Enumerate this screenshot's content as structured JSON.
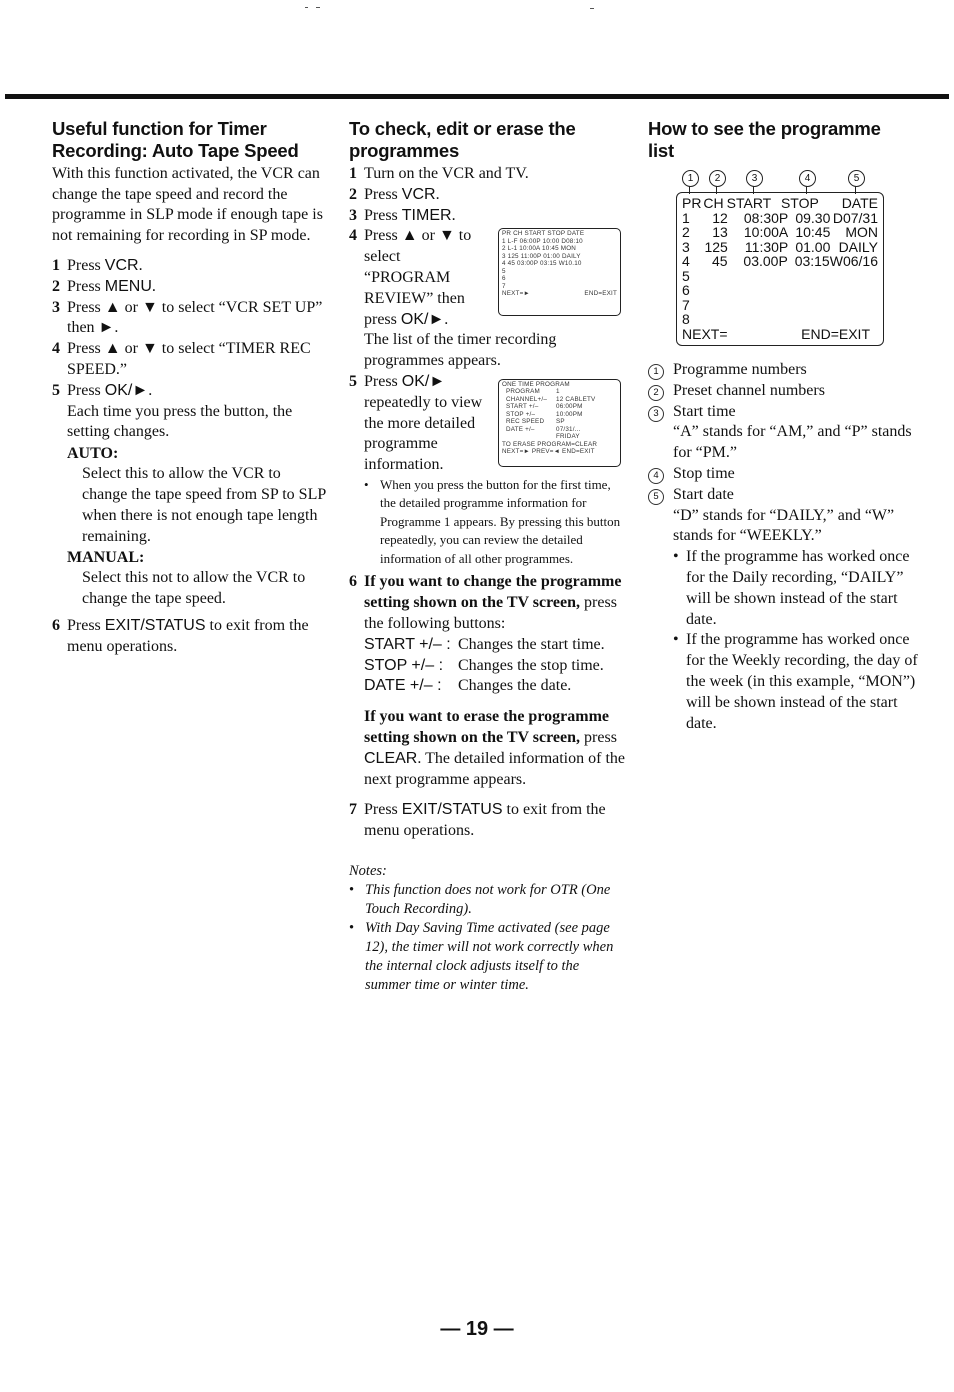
{
  "page_number": "19",
  "column1": {
    "title": "Useful function for Timer Recording: Auto Tape Speed",
    "intro": "With this function activated, the VCR can change the tape speed and record the programme in SLP mode if enough tape is not remaining for recording in SP mode.",
    "steps": [
      {
        "num": "1",
        "pre": "Press ",
        "key": "VCR",
        "post": "."
      },
      {
        "num": "2",
        "pre": "Press ",
        "key": "MENU",
        "post": "."
      },
      {
        "num": "3",
        "pre": "Press ▲ or ▼ to select “VCR SET UP” then ►.",
        "key": "",
        "post": ""
      },
      {
        "num": "4",
        "pre": "Press ▲ or ▼ to select “TIMER REC SPEED.”",
        "key": "",
        "post": ""
      },
      {
        "num": "5",
        "pre": "Press ",
        "key": "OK/►",
        "post": "."
      },
      {
        "num": "6",
        "pre": "Press ",
        "key": "EXIT/STATUS",
        "post": " to exit from the menu operations."
      }
    ],
    "step5_detail": "Each time you press the button, the setting changes.",
    "options": [
      {
        "label": "AUTO:",
        "text": "Select this to allow the VCR to change the tape speed from SP to SLP when there is not enough tape length remaining."
      },
      {
        "label": "MANUAL:",
        "text": "Select this not to allow the VCR to change the tape speed."
      }
    ]
  },
  "column2": {
    "title": "To check, edit or erase the programmes",
    "steps": [
      {
        "num": "1",
        "pre": "Turn on the VCR and TV.",
        "key": "",
        "post": ""
      },
      {
        "num": "2",
        "pre": "Press ",
        "key": "VCR",
        "post": "."
      },
      {
        "num": "3",
        "pre": "Press ",
        "key": "TIMER",
        "post": "."
      },
      {
        "num": "4",
        "pre": "Press ▲ or ▼ to select “PROGRAM REVIEW” then press ",
        "key": "OK/►",
        "post": "."
      },
      {
        "num": "5",
        "pre": "Press ",
        "key": "OK/►",
        "post": " repeatedly to view the more detailed programme information."
      },
      {
        "num": "7",
        "pre": "Press ",
        "key": "EXIT/STATUS",
        "post": " to exit from the menu operations."
      }
    ],
    "step4_lines": [
      "Press ▲ or ▼ to",
      "select",
      "“PROGRAM",
      "REVIEW” then",
      "press"
    ],
    "step4_result": "The list of the timer recording programmes appears.",
    "step5_lines": [
      "repeatedly to view",
      "the more detailed",
      "programme",
      "information."
    ],
    "step5_bullet": "When you press the button for the first time, the detailed programme information for Programme 1 appears. By pressing this button repeatedly, you can review the detailed information of all other programmes.",
    "step6": {
      "num": "6",
      "bold": "If you want to change the programme setting shown on the TV screen,",
      "rest": " press the following buttons:",
      "buttons": [
        {
          "key": "START +/– :",
          "desc": "Changes the start time."
        },
        {
          "key": "STOP +/– :",
          "desc": "Changes the stop time."
        },
        {
          "key": "DATE +/– :",
          "desc": "Changes the date."
        }
      ]
    },
    "erase": {
      "bold": "If you want to erase the programme setting shown on the TV screen,",
      "pre": " press ",
      "key": "CLEAR",
      "post": ". The detailed information of the next programme appears."
    },
    "mini_screen_list": {
      "header": "PR CH START STOP DATE",
      "rows": [
        "1  L-F  06:00P 10:00  D08:10",
        "2  L-1  10:00A 10:45  MON",
        "3  125  11:00P 01:00  DAILY",
        "4  45   03:00P 03:15  W10.10",
        "5",
        "6",
        "7",
        "8"
      ],
      "footer_left": "NEXT=►",
      "footer_right": "END=EXIT"
    },
    "mini_screen_detail": {
      "rows": [
        [
          "ONE TIME PROGRAM",
          ""
        ],
        [
          "PROGRAM",
          "1"
        ],
        [
          "CHANNEL+/–",
          "12 CABLETV"
        ],
        [
          "START +/–",
          "06:00PM"
        ],
        [
          "STOP +/–",
          "10:00PM"
        ],
        [
          "REC SPEED",
          "SP"
        ],
        [
          "DATE +/–",
          "07/31/..."
        ],
        [
          "",
          "FRIDAY"
        ]
      ],
      "erase_line": "TO ERASE PROGRAM=CLEAR",
      "footer": "NEXT=► PREV=◄ END=EXIT"
    },
    "notes": {
      "title": "Notes:",
      "items": [
        "This function does not work for OTR (One Touch Recording).",
        "With Day Saving Time activated (see page 12), the timer will not work correctly when the internal clock adjusts itself to the summer time or winter time."
      ]
    }
  },
  "column3": {
    "title": "How to see the programme list",
    "callouts": [
      "1",
      "2",
      "3",
      "4",
      "5"
    ],
    "screen": {
      "header": [
        "PR",
        "CH",
        "START",
        "STOP",
        "DATE"
      ],
      "rows": [
        [
          "1",
          "12",
          "08:30P",
          "09.30",
          "D07/31"
        ],
        [
          "2",
          "13",
          "10:00A",
          "10:45",
          "MON"
        ],
        [
          "3",
          "125",
          "11:30P",
          "01.00",
          "DAILY"
        ],
        [
          "4",
          "45",
          "03.00P",
          "03:15",
          "W06/16"
        ],
        [
          "5",
          "",
          "",
          "",
          ""
        ],
        [
          "6",
          "",
          "",
          "",
          ""
        ],
        [
          "7",
          "",
          "",
          "",
          ""
        ],
        [
          "8",
          "",
          "",
          "",
          ""
        ]
      ],
      "footer_left": "NEXT=",
      "footer_right": "END=EXIT"
    },
    "legend": [
      {
        "n": "1",
        "label": "Programme numbers",
        "notes": []
      },
      {
        "n": "2",
        "label": "Preset channel numbers",
        "notes": []
      },
      {
        "n": "3",
        "label": "Start time",
        "notes": [
          "“A” stands for “AM,” and “P” stands for “PM.”"
        ]
      },
      {
        "n": "4",
        "label": "Stop time",
        "notes": []
      },
      {
        "n": "5",
        "label": "Start date",
        "notes": [
          "“D” stands for “DAILY,” and “W” stands for “WEEKLY.”"
        ]
      }
    ],
    "bullets": [
      "If the programme has worked once for the Daily recording, “DAILY” will be shown instead of the start date.",
      "If the programme has worked once for the Weekly recording, the day of the week (in this example, “MON”) will be shown instead of the start date."
    ]
  }
}
